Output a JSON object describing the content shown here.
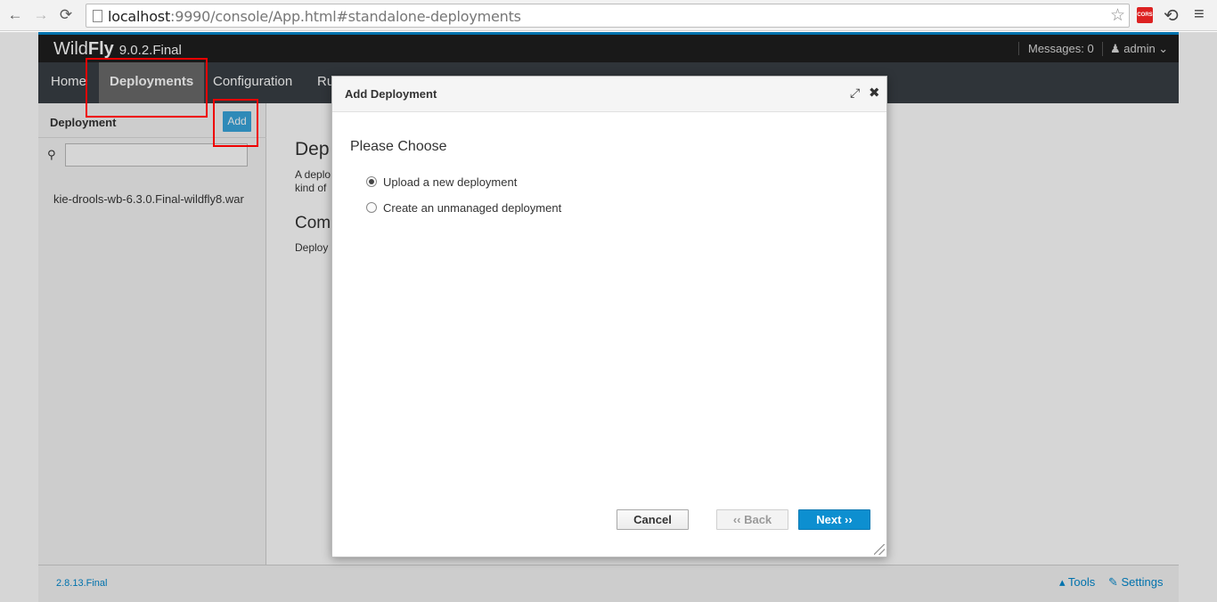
{
  "browser": {
    "url_host": "localhost",
    "url_rest": ":9990/console/App.html#standalone-deployments",
    "back_icon": "←",
    "forward_icon": "→",
    "reload_icon": "⟳",
    "star_icon": "☆",
    "cors_label": "CORS",
    "refresh_ext_icon": "⟲",
    "menu_icon": "≡"
  },
  "app": {
    "brand_wild": "Wild",
    "brand_fly": "Fly",
    "version": "9.0.2.Final",
    "messages": "Messages: 0",
    "user": "admin ⌄",
    "tabs": [
      {
        "label": "Home"
      },
      {
        "label": "Deployments"
      },
      {
        "label": "Configuration"
      },
      {
        "label": "Ru"
      }
    ],
    "sidebar": {
      "title": "Deployment",
      "add_label": "Add",
      "search_icon": "⚲",
      "items": [
        "kie-drools-wb-6.3.0.Final-wildfly8.war"
      ]
    },
    "content": {
      "title": "Dep",
      "desc_line1": "A deplo",
      "desc_line2": "kind of",
      "subtitle": "Com",
      "sub_desc": "Deploy"
    },
    "footer": {
      "version": "2.8.13.Final",
      "tools": "▴ Tools",
      "settings": "✎ Settings"
    }
  },
  "modal": {
    "title": "Add Deployment",
    "expand_icon": "⤢",
    "close_icon": "✖",
    "heading": "Please Choose",
    "options": [
      {
        "label": "Upload a new deployment",
        "checked": true
      },
      {
        "label": "Create an unmanaged deployment",
        "checked": false
      }
    ],
    "cancel_label": "Cancel",
    "back_label": "‹‹ Back",
    "next_label": "Next ››"
  }
}
